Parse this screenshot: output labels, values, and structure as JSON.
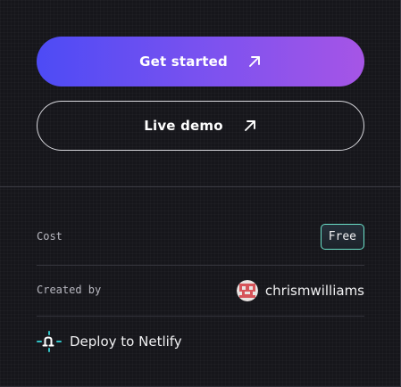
{
  "actions": {
    "primary": {
      "label": "Get started",
      "icon": "arrow-up-right-icon"
    },
    "secondary": {
      "label": "Live demo",
      "icon": "arrow-up-right-icon"
    }
  },
  "details": {
    "cost": {
      "label": "Cost",
      "value": "Free"
    },
    "created_by": {
      "label": "Created by",
      "author": "chrismwilliams",
      "avatar_icon": "avatar"
    }
  },
  "deploy": {
    "label": "Deploy to Netlify",
    "icon": "netlify-icon"
  },
  "colors": {
    "background": "#16161b",
    "primary_gradient_start": "#4d4bf5",
    "primary_gradient_end": "#a655e6",
    "badge_border": "#6ae0c8",
    "netlify_teal": "#32c3c8",
    "avatar_red": "#d6545a"
  }
}
